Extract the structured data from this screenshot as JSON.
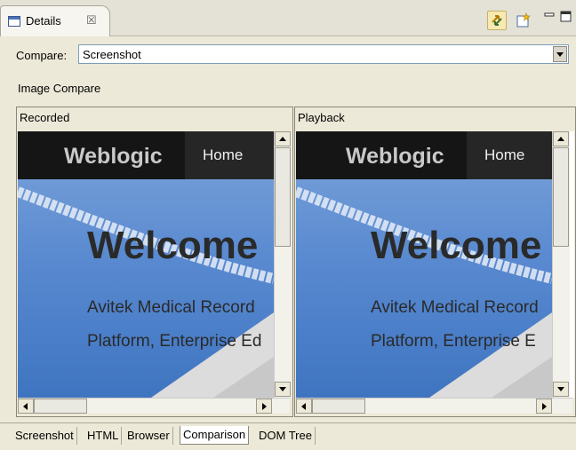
{
  "view_tab": {
    "title": "Details",
    "close": "☒"
  },
  "compare": {
    "label": "Compare:",
    "value": "Screenshot"
  },
  "section_title": "Image Compare",
  "panes": [
    {
      "label": "Recorded",
      "site": {
        "brand": "Weblogic",
        "nav": "Home",
        "heading": "Welcome",
        "line1": "Avitek Medical Record",
        "line2": "Platform, Enterprise Ed"
      }
    },
    {
      "label": "Playback",
      "site": {
        "brand": "Weblogic",
        "nav": "Home",
        "heading": "Welcome",
        "line1": "Avitek Medical Record",
        "line2": "Platform, Enterprise E"
      }
    }
  ],
  "bottom_tabs": [
    "Screenshot",
    "HTML",
    "Browser",
    "Comparison",
    "DOM Tree"
  ],
  "active_tab": "Comparison",
  "icons": [
    "details-view-icon",
    "sync-icon",
    "new-window-icon",
    "minimize-icon",
    "maximize-icon"
  ]
}
